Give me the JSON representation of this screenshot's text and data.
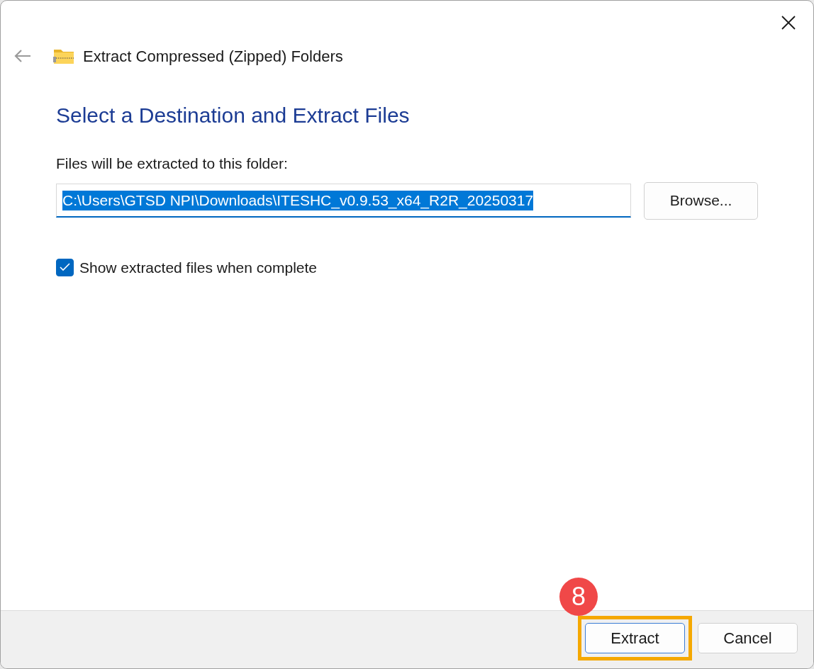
{
  "window": {
    "title": "Extract Compressed (Zipped) Folders"
  },
  "heading": "Select a Destination and Extract Files",
  "destination": {
    "label": "Files will be extracted to this folder:",
    "value": "C:\\Users\\GTSD NPI\\Downloads\\ITESHC_v0.9.53_x64_R2R_20250317",
    "selected": true
  },
  "browse_button": "Browse...",
  "show_files_checkbox": {
    "label": "Show extracted files when complete",
    "checked": true
  },
  "buttons": [
    {
      "label": "Extract",
      "default": true,
      "highlighted": true,
      "step": "8"
    },
    {
      "label": "Cancel",
      "default": false,
      "highlighted": false
    }
  ]
}
